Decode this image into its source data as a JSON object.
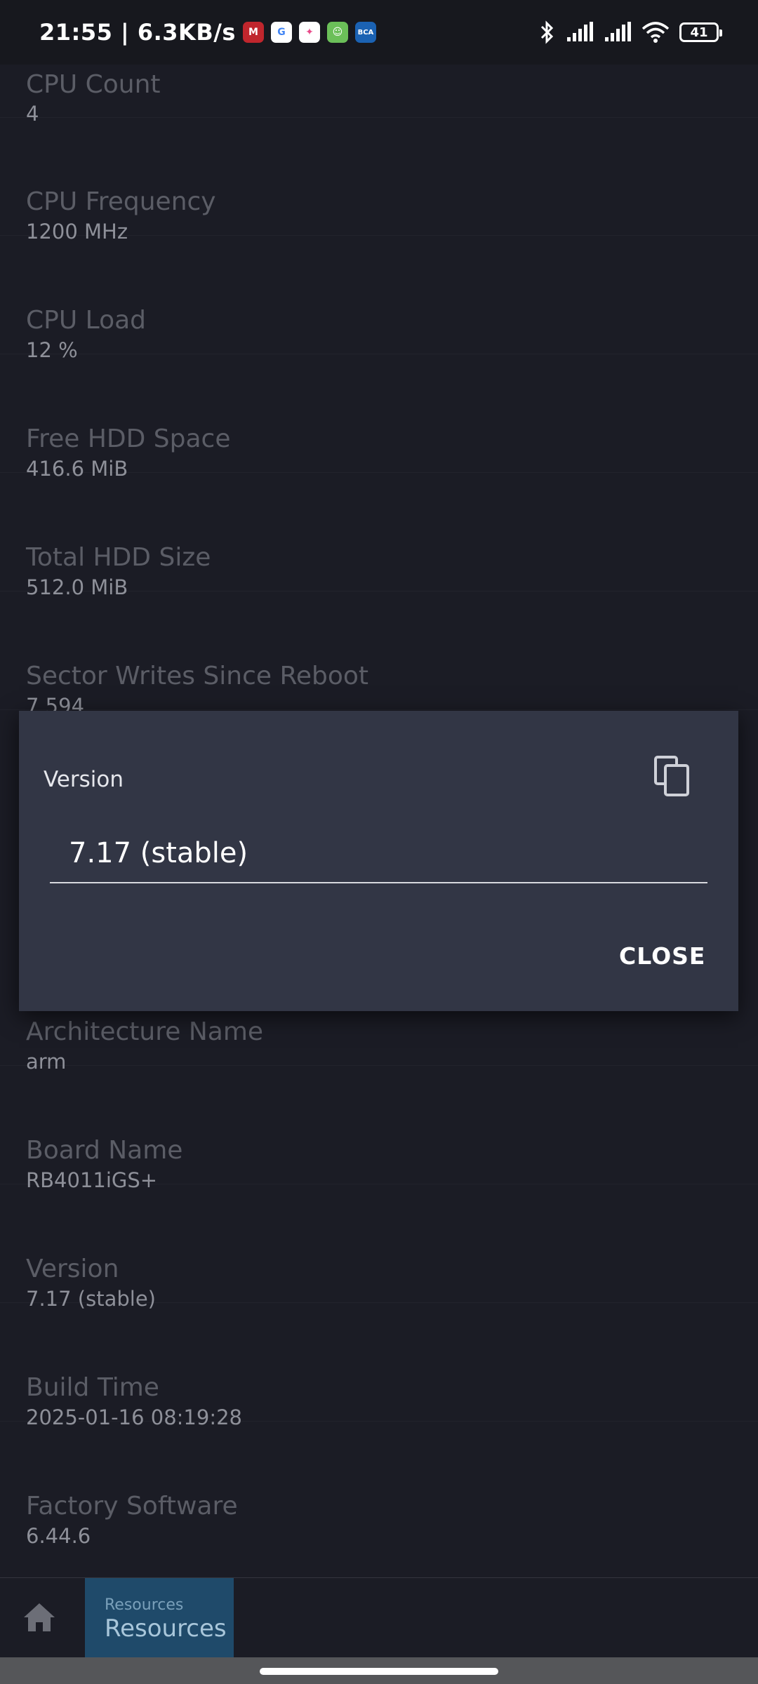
{
  "status_bar": {
    "time_speed": "21:55 | 6.3KB/s",
    "battery": "41",
    "app_icons": [
      {
        "name": "app-red-icon",
        "glyph": "M",
        "color": "#c0262d"
      },
      {
        "name": "google-icon",
        "glyph": "G",
        "color": "#ffffff"
      },
      {
        "name": "colorful-app-icon",
        "glyph": "✦",
        "color": "#2f9be0"
      },
      {
        "name": "green-app-icon",
        "glyph": "☺",
        "color": "#4caf50"
      },
      {
        "name": "bca-icon",
        "glyph": "BCA",
        "color": "#1b62b3"
      }
    ]
  },
  "list": {
    "items": [
      {
        "label": "CPU Count",
        "value": "4"
      },
      {
        "label": "CPU Frequency",
        "value": "1200 MHz"
      },
      {
        "label": "CPU Load",
        "value": "12 %"
      },
      {
        "label": "Free HDD Space",
        "value": "416.6 MiB"
      },
      {
        "label": "Total HDD Size",
        "value": "512.0 MiB"
      },
      {
        "label": "Sector Writes Since Reboot",
        "value": "7 594"
      },
      {
        "label": "",
        "value": ""
      },
      {
        "label": "",
        "value": ""
      },
      {
        "label": "Architecture Name",
        "value": "arm"
      },
      {
        "label": "Board Name",
        "value": "RB4011iGS+"
      },
      {
        "label": "Version",
        "value": "7.17 (stable)"
      },
      {
        "label": "Build Time",
        "value": "2025-01-16 08:19:28"
      },
      {
        "label": "Factory Software",
        "value": "6.44.6"
      }
    ]
  },
  "dialog": {
    "title": "Version",
    "field_value": "7.17 (stable)",
    "close_label": "CLOSE"
  },
  "bottom_nav": {
    "tab_small": "Resources",
    "tab_big": "Resources"
  },
  "colors": {
    "background": "#1b1c25",
    "dialog": "#323645",
    "active_tab": "#1f4a6a"
  }
}
